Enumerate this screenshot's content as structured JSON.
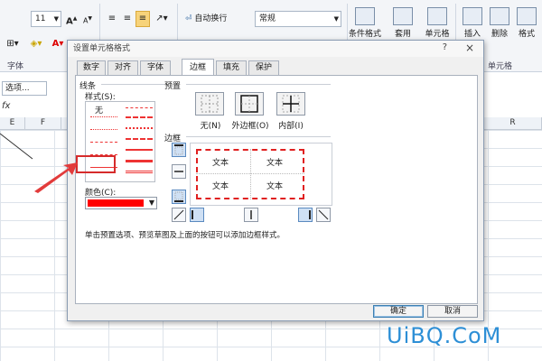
{
  "ribbon": {
    "font_size": "11",
    "grow_font": "A",
    "shrink_font": "A",
    "wrap_text": "自动换行",
    "number_format": "常规",
    "cond_format": "条件格式",
    "table_format": "套用",
    "cell_style": "单元格",
    "insert": "插入",
    "delete": "删除",
    "format": "格式",
    "group_font": "字体",
    "group_cells": "单元格"
  },
  "formula": {
    "name_box": "选项...",
    "fx": "fx"
  },
  "columns": [
    "E",
    "F",
    "R"
  ],
  "dialog": {
    "title": "设置单元格格式",
    "help": "?",
    "close": "×",
    "tabs": [
      "数字",
      "对齐",
      "字体",
      "边框",
      "填充",
      "保护"
    ],
    "active_tab": "边框",
    "line_group": "线条",
    "style_label": "样式(S):",
    "style_none": "无",
    "color_label": "颜色(C):",
    "color_value": "#ff0000",
    "preset_group": "预置",
    "presets": [
      "无(N)",
      "外边框(O)",
      "内部(I)"
    ],
    "border_group": "边框",
    "preview_text": [
      "文本",
      "文本",
      "文本",
      "文本"
    ],
    "hint": "单击预置选项、预览草图及上面的按钮可以添加边框样式。",
    "ok": "确定",
    "cancel": "取消"
  },
  "watermark": "UiBQ.CoM",
  "colors": {
    "accent": "#2d8fd6",
    "highlight": "#d62b2b",
    "border_red": "#e02020"
  }
}
